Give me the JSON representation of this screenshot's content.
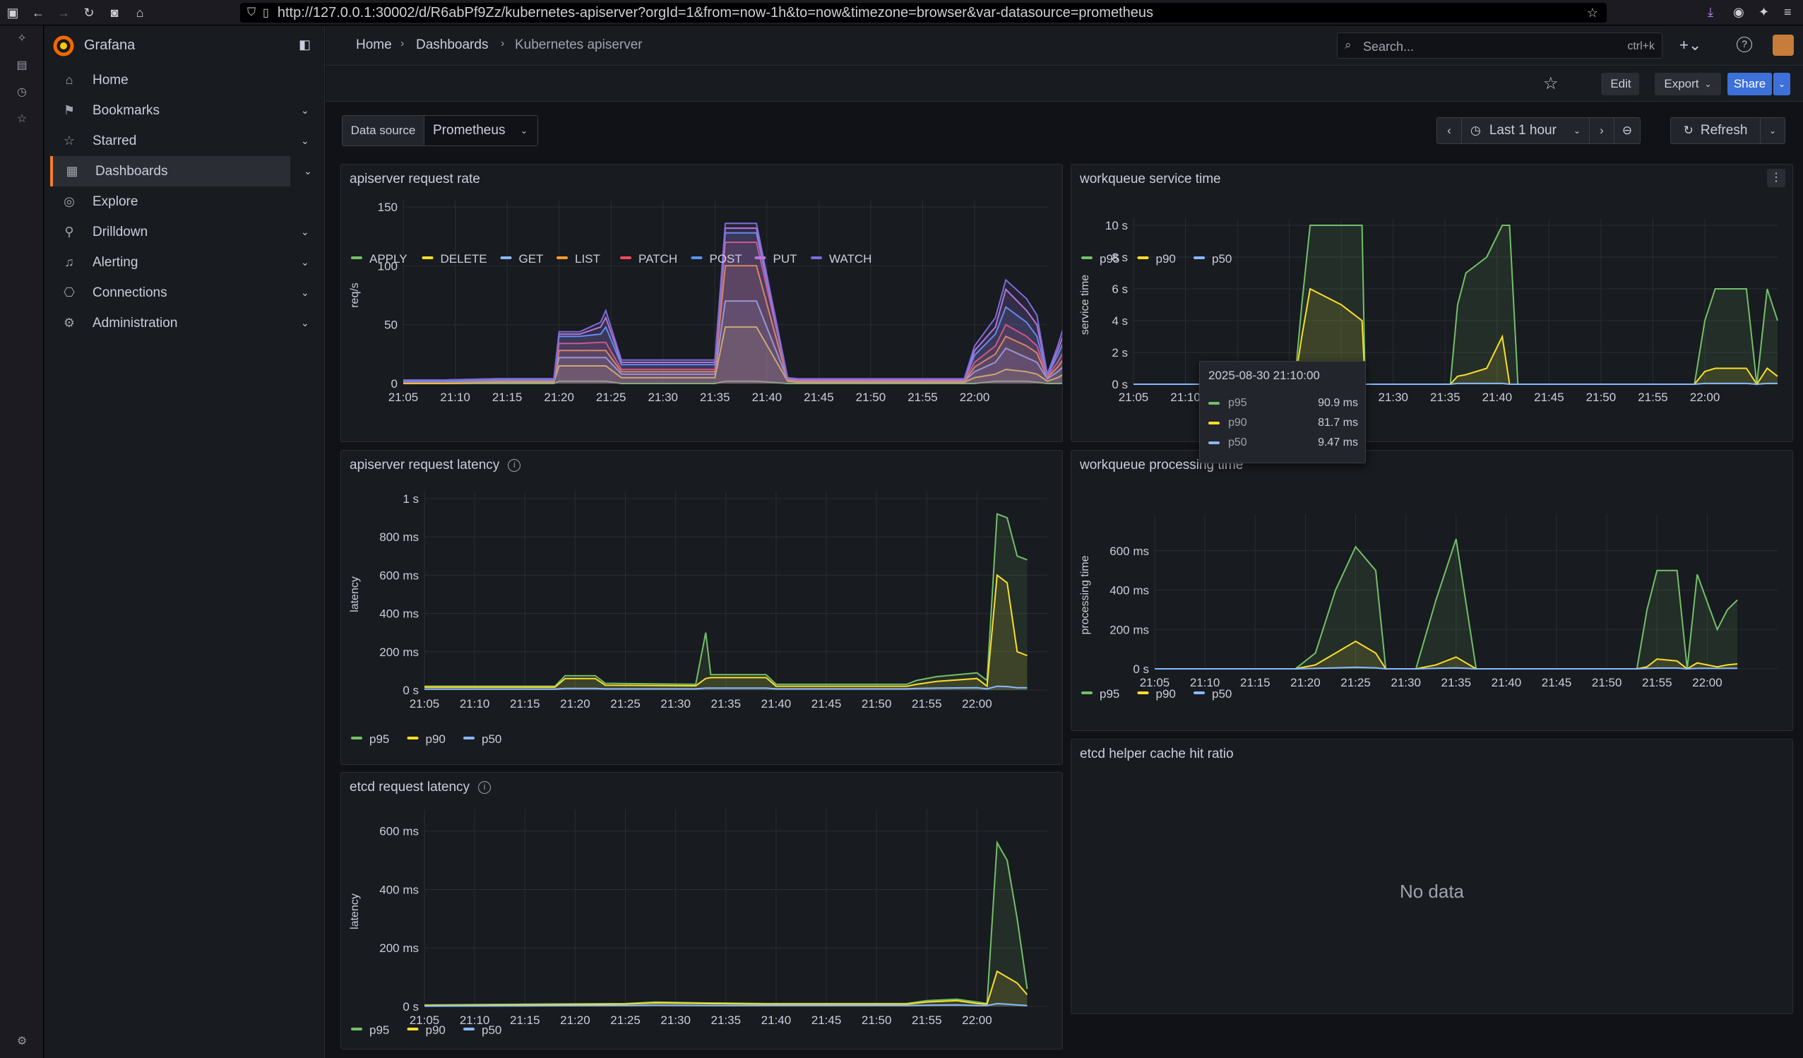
{
  "browser": {
    "url": "http://127.0.0.1:30002/d/R6abPf9Zz/kubernetes-apiserver?orgId=1&from=now-1h&to=now&timezone=browser&var-datasource=prometheus"
  },
  "sidebar": {
    "brand": "Grafana",
    "items": [
      {
        "label": "Home",
        "icon": "home-icon",
        "chevron": false
      },
      {
        "label": "Bookmarks",
        "icon": "bookmark-icon",
        "chevron": true
      },
      {
        "label": "Starred",
        "icon": "star-icon",
        "chevron": true
      },
      {
        "label": "Dashboards",
        "icon": "dashboards-icon",
        "chevron": true,
        "active": true
      },
      {
        "label": "Explore",
        "icon": "compass-icon",
        "chevron": false
      },
      {
        "label": "Drilldown",
        "icon": "drilldown-icon",
        "chevron": true
      },
      {
        "label": "Alerting",
        "icon": "bell-icon",
        "chevron": true
      },
      {
        "label": "Connections",
        "icon": "connections-icon",
        "chevron": true
      },
      {
        "label": "Administration",
        "icon": "gear-icon",
        "chevron": true
      }
    ]
  },
  "header": {
    "breadcrumb": [
      "Home",
      "Dashboards",
      "Kubernetes apiserver"
    ],
    "search_placeholder": "Search...",
    "search_shortcut": "ctrl+k"
  },
  "toolbar": {
    "edit": "Edit",
    "export": "Export",
    "share": "Share",
    "time_range": "Last 1 hour",
    "refresh": "Refresh"
  },
  "variables": {
    "label": "Data source",
    "value": "Prometheus"
  },
  "colors": {
    "green": "#73bf69",
    "yellow": "#fade2a",
    "blue": "#8ab8ff",
    "orange": "#ff9830",
    "red": "#f2495c",
    "blue2": "#5794f2",
    "purple": "#b877d9",
    "violet": "#7d6cd8"
  },
  "tooltip": {
    "title": "2025-08-30 21:10:00",
    "rows": [
      {
        "name": "p95",
        "value": "90.9 ms"
      },
      {
        "name": "p90",
        "value": "81.7 ms"
      },
      {
        "name": "p50",
        "value": "9.47 ms"
      }
    ]
  },
  "panels": {
    "etcd_cache": {
      "title": "etcd helper cache hit ratio",
      "message": "No data"
    }
  },
  "chart_data": [
    {
      "id": "request_rate",
      "type": "line",
      "title": "apiserver request rate",
      "ylabel": "req/s",
      "ylim": [
        0,
        150
      ],
      "yticks": [
        "0",
        "50",
        "100",
        "150"
      ],
      "xticks": [
        "21:05",
        "21:10",
        "21:15",
        "21:20",
        "21:25",
        "21:30",
        "21:35",
        "21:40",
        "21:45",
        "21:50",
        "21:55",
        "22:00"
      ],
      "x": [
        0,
        4,
        9,
        11,
        14.5,
        15,
        17,
        19,
        19.5,
        21,
        22,
        23,
        25,
        26,
        27,
        30,
        31,
        32,
        34,
        37,
        38,
        39,
        40,
        41,
        42,
        44,
        50,
        54,
        55,
        57,
        58,
        60,
        61,
        62,
        63,
        64,
        65
      ],
      "series": [
        {
          "name": "APPLY",
          "color": "#73bf69",
          "values": [
            0,
            0,
            0,
            0,
            0,
            2,
            2,
            2,
            2,
            0,
            0,
            0,
            0,
            0,
            0,
            0,
            2,
            2,
            2,
            0,
            0,
            0,
            0,
            0,
            0,
            0,
            0,
            0,
            0,
            2,
            2,
            2,
            1,
            0,
            0,
            0,
            0
          ]
        },
        {
          "name": "DELETE",
          "color": "#fade2a",
          "values": [
            0,
            0,
            1,
            1,
            1,
            15,
            15,
            15,
            15,
            5,
            5,
            5,
            5,
            5,
            5,
            5,
            48,
            48,
            48,
            2,
            1,
            1,
            1,
            1,
            1,
            1,
            1,
            1,
            5,
            8,
            12,
            10,
            8,
            2,
            5,
            10,
            16
          ]
        },
        {
          "name": "GET",
          "color": "#8ab8ff",
          "values": [
            1,
            1,
            2,
            2,
            2,
            22,
            22,
            22,
            22,
            8,
            8,
            8,
            8,
            8,
            8,
            8,
            70,
            70,
            70,
            3,
            2,
            2,
            2,
            2,
            2,
            2,
            2,
            2,
            10,
            18,
            30,
            22,
            18,
            4,
            10,
            18,
            28
          ]
        },
        {
          "name": "LIST",
          "color": "#ff9830",
          "values": [
            1,
            1,
            2,
            2,
            2,
            28,
            28,
            28,
            28,
            10,
            10,
            10,
            10,
            10,
            10,
            10,
            100,
            100,
            100,
            3,
            2,
            2,
            2,
            2,
            2,
            2,
            2,
            2,
            14,
            25,
            40,
            32,
            26,
            5,
            14,
            26,
            38
          ]
        },
        {
          "name": "PATCH",
          "color": "#f2495c",
          "values": [
            2,
            2,
            3,
            3,
            3,
            34,
            34,
            35,
            35,
            12,
            12,
            12,
            12,
            12,
            12,
            12,
            120,
            120,
            120,
            4,
            3,
            3,
            3,
            3,
            3,
            3,
            3,
            3,
            18,
            32,
            50,
            40,
            32,
            6,
            18,
            34,
            50
          ]
        },
        {
          "name": "POST",
          "color": "#5794f2",
          "values": [
            2,
            2,
            3,
            3,
            3,
            40,
            40,
            42,
            48,
            16,
            16,
            16,
            16,
            16,
            16,
            16,
            128,
            128,
            128,
            4,
            3,
            3,
            3,
            3,
            3,
            3,
            3,
            3,
            24,
            42,
            65,
            52,
            40,
            7,
            24,
            44,
            60
          ]
        },
        {
          "name": "PUT",
          "color": "#b877d9",
          "values": [
            3,
            3,
            4,
            4,
            4,
            42,
            42,
            48,
            56,
            18,
            18,
            18,
            18,
            18,
            18,
            18,
            132,
            132,
            132,
            4,
            3,
            3,
            3,
            3,
            3,
            3,
            3,
            3,
            28,
            48,
            80,
            62,
            50,
            8,
            28,
            52,
            72
          ]
        },
        {
          "name": "WATCH",
          "color": "#7d6cd8",
          "values": [
            3,
            3,
            4,
            4,
            4,
            44,
            44,
            52,
            62,
            20,
            20,
            20,
            20,
            20,
            20,
            20,
            136,
            136,
            136,
            5,
            4,
            4,
            4,
            4,
            4,
            4,
            4,
            4,
            32,
            56,
            88,
            72,
            58,
            8,
            32,
            60,
            84
          ]
        }
      ]
    },
    {
      "id": "workqueue_service",
      "type": "line",
      "title": "workqueue service time",
      "ylabel": "service time",
      "ylim": [
        0,
        10
      ],
      "yticks": [
        "0 s",
        "2 s",
        "4 s",
        "6 s",
        "8 s",
        "10 s"
      ],
      "xticks": [
        "21:05",
        "21:10",
        "21:15",
        "21:20",
        "21:25",
        "21:30",
        "21:35",
        "21:40",
        "21:45",
        "21:50",
        "21:55",
        "22:00"
      ],
      "x": [
        0,
        10,
        15.5,
        16.2,
        17,
        20,
        22,
        22.3,
        24,
        30.5,
        31.2,
        32,
        34,
        35.5,
        36.2,
        37,
        40,
        50,
        54,
        55,
        56,
        59,
        60,
        61,
        62
      ],
      "series": [
        {
          "name": "p95",
          "color": "#73bf69",
          "values": [
            0,
            0,
            0,
            5,
            10,
            10,
            10,
            0,
            0,
            0,
            5,
            7,
            8,
            10,
            10,
            0,
            0,
            0,
            0,
            4,
            6,
            6,
            0,
            6,
            4
          ]
        },
        {
          "name": "p90",
          "color": "#fade2a",
          "values": [
            0,
            0,
            0,
            3,
            6,
            5,
            4,
            0,
            0,
            0,
            0.5,
            0.6,
            1,
            3,
            0,
            0,
            0,
            0,
            0,
            0.8,
            1,
            1,
            0,
            1,
            0.5
          ]
        },
        {
          "name": "p50",
          "color": "#8ab8ff",
          "values": [
            0,
            0,
            0,
            0.05,
            0.1,
            0.1,
            0.1,
            0,
            0,
            0,
            0.05,
            0.05,
            0.05,
            0.05,
            0,
            0,
            0,
            0,
            0,
            0.05,
            0.05,
            0.05,
            0,
            0.05,
            0.05
          ]
        }
      ]
    },
    {
      "id": "apiserver_latency",
      "type": "line",
      "title": "apiserver request latency",
      "ylabel": "latency",
      "ylim": [
        0,
        1000
      ],
      "yticks": [
        "0 s",
        "200 ms",
        "400 ms",
        "600 ms",
        "800 ms",
        "1 s"
      ],
      "xticks": [
        "21:05",
        "21:10",
        "21:15",
        "21:20",
        "21:25",
        "21:30",
        "21:35",
        "21:40",
        "21:45",
        "21:50",
        "21:55",
        "22:00"
      ],
      "x": [
        0,
        13,
        14,
        17,
        18,
        27,
        28,
        28.5,
        29,
        34,
        35,
        48,
        49,
        51,
        55,
        56,
        57,
        58,
        59,
        60
      ],
      "series": [
        {
          "name": "p95",
          "color": "#73bf69",
          "values": [
            20,
            20,
            75,
            75,
            35,
            30,
            300,
            80,
            80,
            80,
            30,
            30,
            50,
            70,
            90,
            50,
            920,
            900,
            700,
            680
          ]
        },
        {
          "name": "p90",
          "color": "#fade2a",
          "values": [
            15,
            15,
            60,
            60,
            25,
            22,
            60,
            65,
            65,
            65,
            20,
            20,
            30,
            45,
            60,
            20,
            600,
            560,
            200,
            180
          ]
        },
        {
          "name": "p50",
          "color": "#8ab8ff",
          "values": [
            5,
            5,
            8,
            8,
            6,
            6,
            10,
            10,
            10,
            10,
            6,
            6,
            8,
            10,
            12,
            6,
            20,
            18,
            12,
            12
          ]
        }
      ]
    },
    {
      "id": "workqueue_processing",
      "type": "line",
      "title": "workqueue processing time",
      "ylabel": "processing time",
      "ylim": [
        0,
        750
      ],
      "yticks": [
        "0 s",
        "200 ms",
        "400 ms",
        "600 ms"
      ],
      "xticks": [
        "21:05",
        "21:10",
        "21:15",
        "21:20",
        "21:25",
        "21:30",
        "21:35",
        "21:40",
        "21:45",
        "21:50",
        "21:55",
        "22:00"
      ],
      "x": [
        0,
        14,
        16,
        18,
        20,
        22,
        23,
        26,
        28,
        30,
        32,
        33,
        34,
        44,
        48,
        49,
        50,
        52,
        53,
        54,
        56,
        57,
        58
      ],
      "series": [
        {
          "name": "p95",
          "color": "#73bf69",
          "values": [
            0,
            0,
            80,
            400,
            620,
            500,
            0,
            0,
            350,
            660,
            0,
            0,
            0,
            0,
            0,
            300,
            500,
            500,
            0,
            480,
            200,
            300,
            350
          ]
        },
        {
          "name": "p90",
          "color": "#fade2a",
          "values": [
            0,
            0,
            20,
            80,
            140,
            80,
            0,
            0,
            20,
            60,
            0,
            0,
            0,
            0,
            0,
            10,
            50,
            40,
            0,
            30,
            10,
            20,
            25
          ]
        },
        {
          "name": "p50",
          "color": "#8ab8ff",
          "values": [
            0,
            0,
            2,
            5,
            8,
            5,
            0,
            0,
            3,
            5,
            0,
            0,
            0,
            0,
            0,
            2,
            4,
            4,
            0,
            3,
            2,
            3,
            3
          ]
        }
      ]
    },
    {
      "id": "etcd_latency",
      "type": "line",
      "title": "etcd request latency",
      "ylabel": "latency",
      "ylim": [
        0,
        650
      ],
      "yticks": [
        "0 s",
        "200 ms",
        "400 ms",
        "600 ms"
      ],
      "xticks": [
        "21:05",
        "21:10",
        "21:15",
        "21:20",
        "21:25",
        "21:30",
        "21:35",
        "21:40",
        "21:45",
        "21:50",
        "21:55",
        "22:00"
      ],
      "x": [
        0,
        10,
        20,
        23,
        28,
        34,
        40,
        48,
        50,
        53,
        55,
        56,
        57,
        58,
        59,
        60
      ],
      "series": [
        {
          "name": "p95",
          "color": "#73bf69",
          "values": [
            5,
            8,
            10,
            15,
            12,
            10,
            10,
            10,
            20,
            25,
            15,
            10,
            560,
            500,
            300,
            60
          ]
        },
        {
          "name": "p90",
          "color": "#fade2a",
          "values": [
            3,
            5,
            8,
            12,
            10,
            8,
            8,
            8,
            15,
            20,
            10,
            8,
            120,
            100,
            80,
            40
          ]
        },
        {
          "name": "p50",
          "color": "#8ab8ff",
          "values": [
            1,
            2,
            3,
            4,
            3,
            3,
            3,
            3,
            4,
            5,
            3,
            3,
            10,
            8,
            5,
            3
          ]
        }
      ]
    }
  ]
}
